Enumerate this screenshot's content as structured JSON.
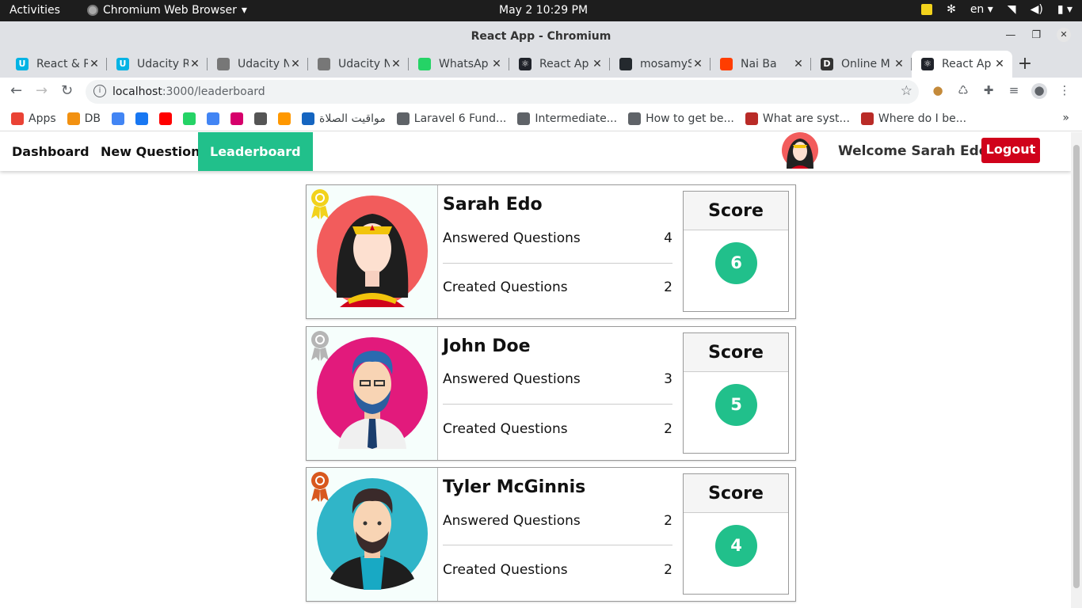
{
  "os": {
    "activities": "Activities",
    "app_name": "Chromium Web Browser",
    "clock": "May 2  10:29 PM",
    "lang": "en"
  },
  "window": {
    "title": "React App - Chromium"
  },
  "tabs": [
    {
      "label": "React & R",
      "favicon_color": "#02b3e4",
      "fav_char": "U"
    },
    {
      "label": "Udacity R",
      "favicon_color": "#02b3e4",
      "fav_char": "U"
    },
    {
      "label": "Udacity N",
      "favicon_color": "#777777",
      "fav_char": ""
    },
    {
      "label": "Udacity N",
      "favicon_color": "#777777",
      "fav_char": ""
    },
    {
      "label": "WhatsAp",
      "favicon_color": "#25d366",
      "fav_char": ""
    },
    {
      "label": "React Ap",
      "favicon_color": "#20232a",
      "fav_char": "⚛"
    },
    {
      "label": "mosamyS",
      "favicon_color": "#24292e",
      "fav_char": ""
    },
    {
      "label": "Nai Ba",
      "favicon_color": "#ff3d00",
      "fav_char": ""
    },
    {
      "label": "Online M",
      "favicon_color": "#333333",
      "fav_char": "D"
    },
    {
      "label": "React Ap",
      "favicon_color": "#20232a",
      "fav_char": "⚛",
      "active": true
    }
  ],
  "toolbar": {
    "url_host": "localhost",
    "url_path": ":3000/leaderboard"
  },
  "bookmarks": [
    {
      "label": "Apps",
      "color": "#ea4335"
    },
    {
      "label": "DB",
      "color": "#f29111"
    },
    {
      "label": "",
      "color": "#4285f4"
    },
    {
      "label": "",
      "color": "#1877f2"
    },
    {
      "label": "",
      "color": "#ff0000"
    },
    {
      "label": "",
      "color": "#25d366"
    },
    {
      "label": "",
      "color": "#4285f4"
    },
    {
      "label": "",
      "color": "#d6006b"
    },
    {
      "label": "",
      "color": "#555555"
    },
    {
      "label": "",
      "color": "#ff9800"
    },
    {
      "label": "مواقيت الصلاة",
      "color": "#1565c0"
    },
    {
      "label": "Laravel 6 Fund...",
      "color": "#5f6368"
    },
    {
      "label": "Intermediate...",
      "color": "#5f6368"
    },
    {
      "label": "How to get be...",
      "color": "#5f6368"
    },
    {
      "label": "What are syst...",
      "color": "#b92b27"
    },
    {
      "label": "Where do I be...",
      "color": "#b92b27"
    }
  ],
  "nav": {
    "dashboard": "Dashboard",
    "new_question": "New Question",
    "leaderboard": "Leaderboard",
    "welcome": "Welcome Sarah Edo",
    "logout": "Logout"
  },
  "leaderboard": [
    {
      "name": "Sarah Edo",
      "answered_label": "Answered Questions",
      "answered": "4",
      "created_label": "Created Questions",
      "created": "2",
      "score_label": "Score",
      "score": "6",
      "ribbon_color": "#f2d21c"
    },
    {
      "name": "John Doe",
      "answered_label": "Answered Questions",
      "answered": "3",
      "created_label": "Created Questions",
      "created": "2",
      "score_label": "Score",
      "score": "5",
      "ribbon_color": "#b5b5b5"
    },
    {
      "name": "Tyler McGinnis",
      "answered_label": "Answered Questions",
      "answered": "2",
      "created_label": "Created Questions",
      "created": "2",
      "score_label": "Score",
      "score": "4",
      "ribbon_color": "#d8581e"
    }
  ],
  "colors": {
    "accent": "#21c08b",
    "logout": "#d0021b"
  }
}
